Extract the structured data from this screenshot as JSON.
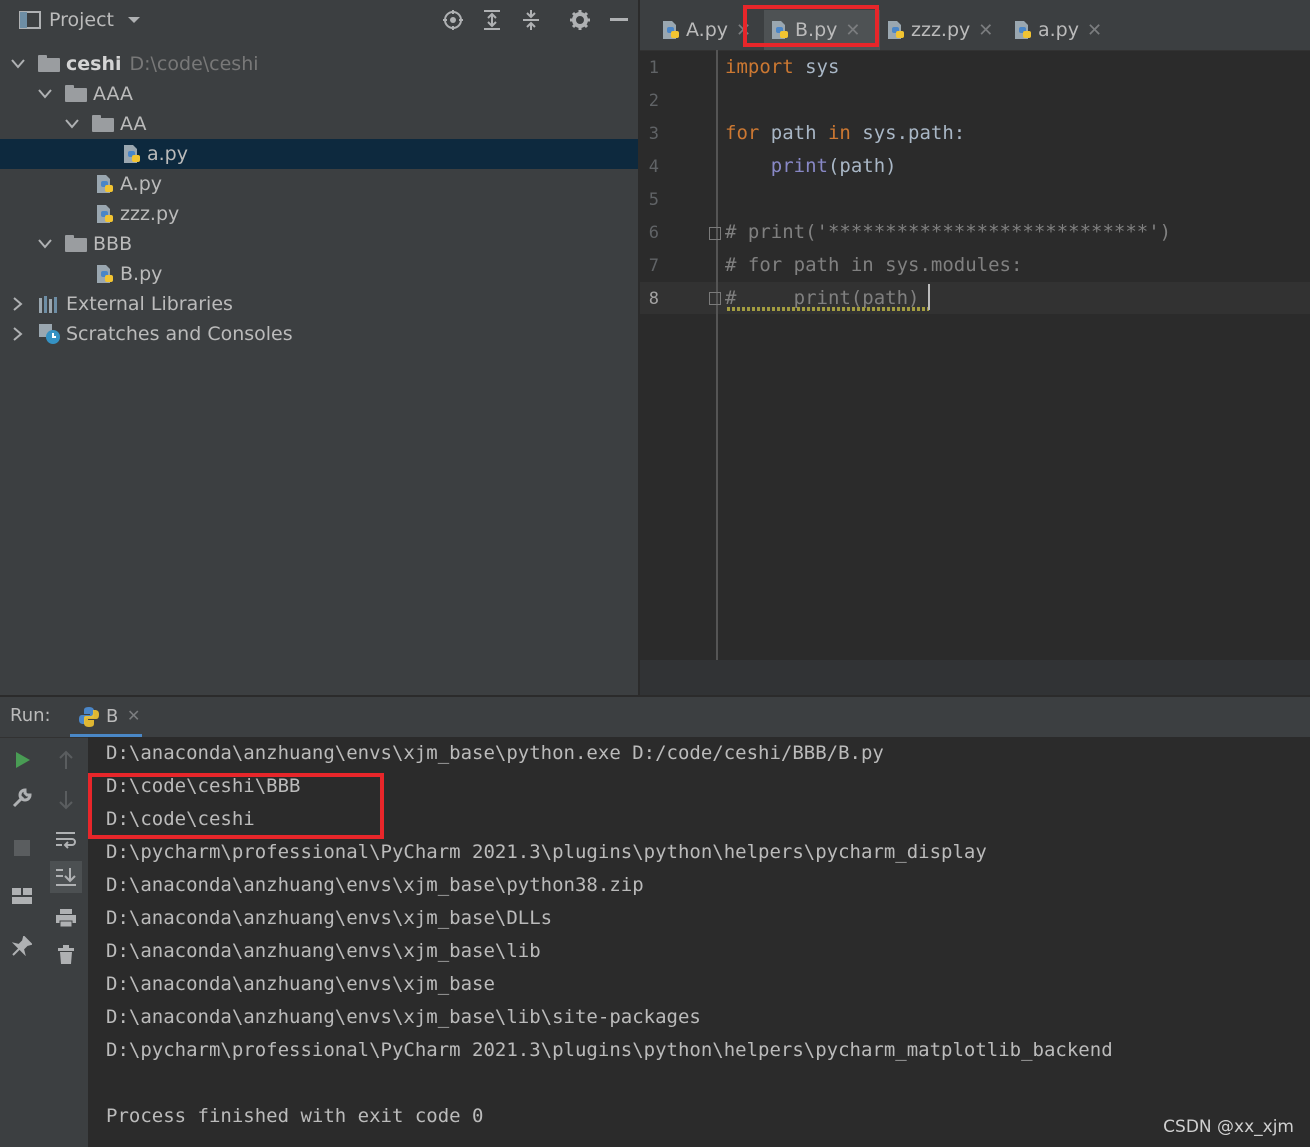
{
  "project_panel": {
    "title": "Project",
    "tree": [
      {
        "label": "ceshi",
        "path": "D:\\code\\ceshi"
      },
      {
        "label": "AAA"
      },
      {
        "label": "AA"
      },
      {
        "label": "a.py"
      },
      {
        "label": "A.py"
      },
      {
        "label": "zzz.py"
      },
      {
        "label": "BBB"
      },
      {
        "label": "B.py"
      },
      {
        "label": "External Libraries"
      },
      {
        "label": "Scratches and Consoles"
      }
    ]
  },
  "editor": {
    "tabs": [
      {
        "label": "A.py"
      },
      {
        "label": "B.py"
      },
      {
        "label": "zzz.py"
      },
      {
        "label": "a.py"
      }
    ],
    "line_numbers": [
      "1",
      "2",
      "3",
      "4",
      "5",
      "6",
      "7",
      "8"
    ],
    "code": {
      "l1_kw": "import",
      "l1_rest": " sys",
      "l3_kw1": "for",
      "l3_mid": " path ",
      "l3_kw2": "in",
      "l3_rest": " sys.path:",
      "l4_indent": "    ",
      "l4_bi": "print",
      "l4_rest": "(path)",
      "l6": "# print('****************************')",
      "l7": "# for path in sys.modules:",
      "l8": "#     print(path)"
    }
  },
  "run_panel": {
    "label": "Run:",
    "tab_label": "B",
    "output": [
      "D:\\anaconda\\anzhuang\\envs\\xjm_base\\python.exe D:/code/ceshi/BBB/B.py",
      "D:\\code\\ceshi\\BBB",
      "D:\\code\\ceshi",
      "D:\\pycharm\\professional\\PyCharm 2021.3\\plugins\\python\\helpers\\pycharm_display",
      "D:\\anaconda\\anzhuang\\envs\\xjm_base\\python38.zip",
      "D:\\anaconda\\anzhuang\\envs\\xjm_base\\DLLs",
      "D:\\anaconda\\anzhuang\\envs\\xjm_base\\lib",
      "D:\\anaconda\\anzhuang\\envs\\xjm_base",
      "D:\\anaconda\\anzhuang\\envs\\xjm_base\\lib\\site-packages",
      "D:\\pycharm\\professional\\PyCharm 2021.3\\plugins\\python\\helpers\\pycharm_matplotlib_backend",
      "",
      "Process finished with exit code 0"
    ]
  },
  "watermark": "CSDN @xx_xjm",
  "colors": {
    "highlight": "#e8262a",
    "keyword": "#cc7832",
    "builtin": "#8888c6",
    "comment": "#808080"
  }
}
